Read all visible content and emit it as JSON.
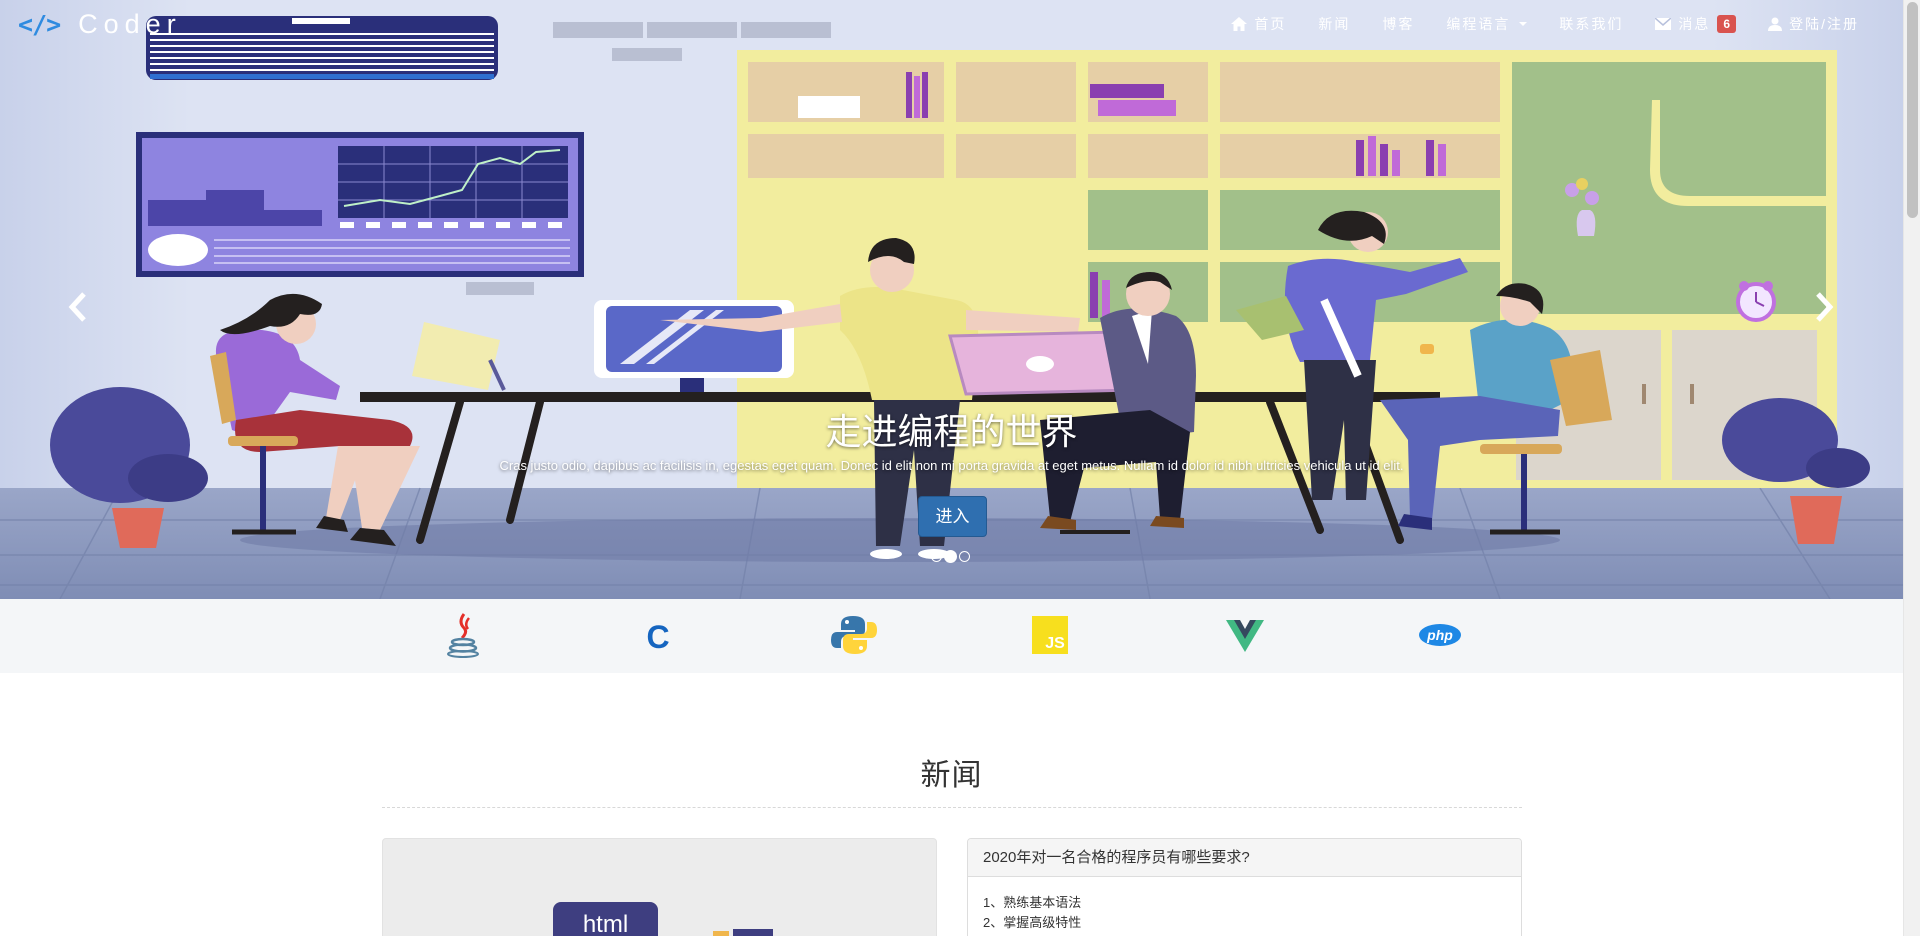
{
  "brand": {
    "icon": "</>",
    "name": "Coder"
  },
  "nav": {
    "home": "首页",
    "news": "新闻",
    "blog": "博客",
    "languages": "编程语言",
    "contact": "联系我们",
    "messages": "消息",
    "message_count": "6",
    "login": "登陆/注册"
  },
  "carousel": {
    "title": "走进编程的世界",
    "text": "Cras justo odio, dapibus ac facilisis in, egestas eget quam. Donec id elit non mi porta gravida at eget metus. Nullam id dolor id nibh ultricies vehicula ut id elit.",
    "button": "进入",
    "slide_count": 3,
    "active_slide": 1
  },
  "languages_bar": [
    {
      "icon": "java-icon"
    },
    {
      "icon": "c-icon",
      "glyph": "C"
    },
    {
      "icon": "python-icon"
    },
    {
      "icon": "javascript-icon",
      "glyph": "JS"
    },
    {
      "icon": "vue-icon"
    },
    {
      "icon": "php-icon",
      "glyph": "php"
    }
  ],
  "news": {
    "heading": "新闻",
    "image_tag": "html",
    "article": {
      "title": "2020年对一名合格的程序员有哪些要求?",
      "items": [
        "1、熟练基本语法",
        "2、掌握高级特性"
      ]
    }
  },
  "colors": {
    "brand_blue": "#2f8be0",
    "badge_red": "#d9534f",
    "button_blue": "#2f6fb0",
    "wall": "#d9e0f2",
    "floor": "#8c9ac0"
  }
}
